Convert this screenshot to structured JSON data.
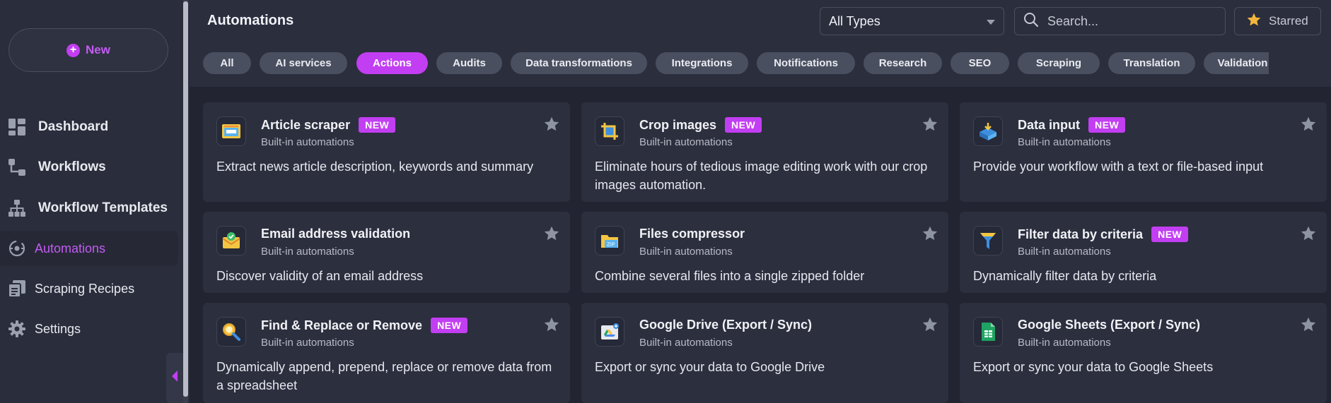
{
  "sidebar": {
    "new_label": "New",
    "items": [
      {
        "label": "Dashboard",
        "icon": "dashboard-icon"
      },
      {
        "label": "Workflows",
        "icon": "workflow-icon"
      },
      {
        "label": "Workflow Templates",
        "icon": "templates-icon"
      },
      {
        "label": "Automations",
        "icon": "automations-icon",
        "active": true
      },
      {
        "label": "Scraping Recipes",
        "icon": "scraping-recipes-icon"
      },
      {
        "label": "Settings",
        "icon": "gear-icon"
      }
    ]
  },
  "header": {
    "title": "Automations",
    "type_filter": "All Types",
    "search_placeholder": "Search...",
    "starred_label": "Starred"
  },
  "chips": [
    {
      "label": "All"
    },
    {
      "label": "AI services"
    },
    {
      "label": "Actions",
      "active": true
    },
    {
      "label": "Audits"
    },
    {
      "label": "Data transformations"
    },
    {
      "label": "Integrations"
    },
    {
      "label": "Notifications"
    },
    {
      "label": "Research"
    },
    {
      "label": "SEO"
    },
    {
      "label": "Scraping"
    },
    {
      "label": "Translation"
    },
    {
      "label": "Validation"
    }
  ],
  "cards": [
    {
      "title": "Article scraper",
      "badge": "NEW",
      "subtitle": "Built-in automations",
      "description": "Extract news article description, keywords and summary",
      "icon": "article-scraper-icon"
    },
    {
      "title": "Crop images",
      "badge": "NEW",
      "subtitle": "Built-in automations",
      "description": "Eliminate hours of tedious image editing work with our crop images automation.",
      "icon": "crop-images-icon"
    },
    {
      "title": "Data input",
      "badge": "NEW",
      "subtitle": "Built-in automations",
      "description": "Provide your workflow with a text or file-based input",
      "icon": "data-input-icon"
    },
    {
      "title": "Email address validation",
      "badge": "",
      "subtitle": "Built-in automations",
      "description": "Discover validity of an email address",
      "icon": "email-validation-icon"
    },
    {
      "title": "Files compressor",
      "badge": "",
      "subtitle": "Built-in automations",
      "description": "Combine several files into a single zipped folder",
      "icon": "zip-folder-icon"
    },
    {
      "title": "Filter data by criteria",
      "badge": "NEW",
      "subtitle": "Built-in automations",
      "description": "Dynamically filter data by criteria",
      "icon": "filter-icon"
    },
    {
      "title": "Find & Replace or Remove",
      "badge": "NEW",
      "subtitle": "Built-in automations",
      "description": "Dynamically append, prepend, replace or remove data from a spreadsheet",
      "icon": "find-replace-icon"
    },
    {
      "title": "Google Drive (Export / Sync)",
      "badge": "",
      "subtitle": "Built-in automations",
      "description": "Export or sync your data to Google Drive",
      "icon": "google-drive-icon"
    },
    {
      "title": "Google Sheets (Export / Sync)",
      "badge": "",
      "subtitle": "Built-in automations",
      "description": "Export or sync your data to Google Sheets",
      "icon": "google-sheets-icon"
    }
  ],
  "colors": {
    "accent": "#c23ef2",
    "background": "#2b2e3d",
    "card": "#2c2f3e",
    "chip": "#4a4f60"
  }
}
